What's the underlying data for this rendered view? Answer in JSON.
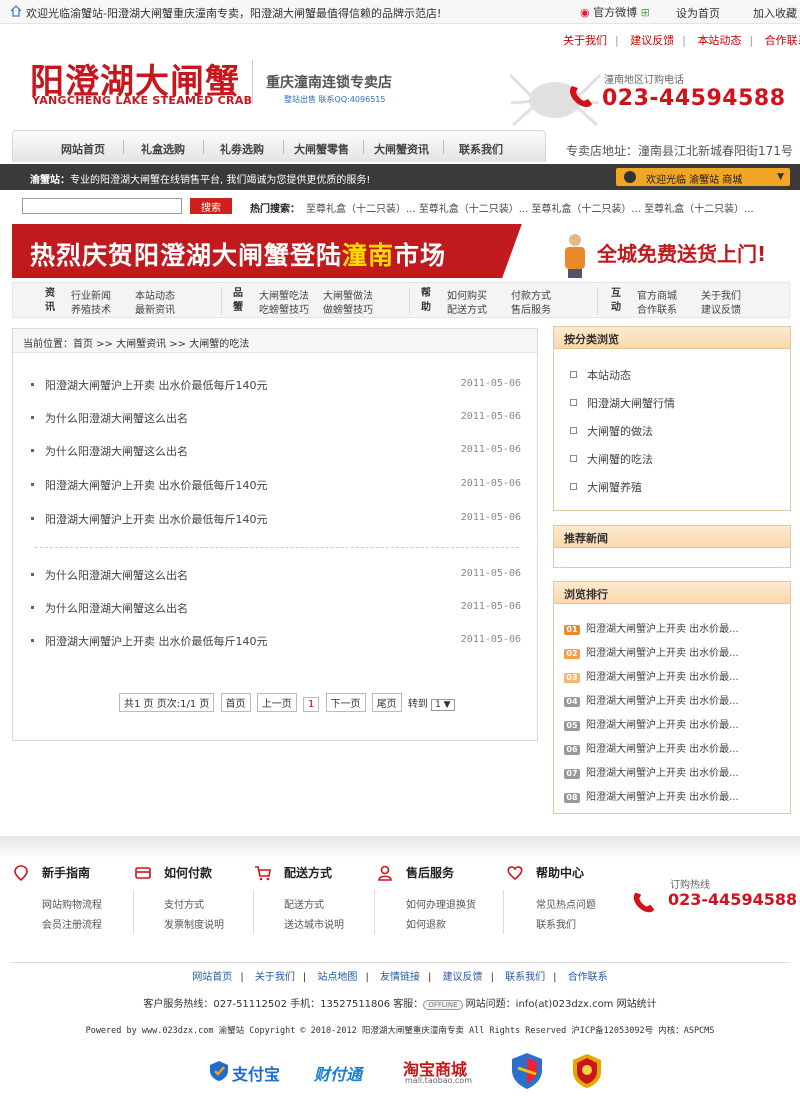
{
  "topbar": {
    "welcome": "欢迎光临渝蟹站-阳澄湖大闸蟹重庆潼南专卖，阳澄湖大闸蟹最值得信赖的品牌示范店!",
    "weibo": "官方微博",
    "set_home": "设为首页",
    "favorite": "加入收藏"
  },
  "sublinks": [
    "关于我们",
    "建议反馈",
    "本站动态",
    "合作联系"
  ],
  "logo": {
    "cn": "阳澄湖大闸蟹",
    "en": "YANGCHENG LAKE STEAMED CRAB"
  },
  "store": {
    "name": "重庆潼南连锁专卖店",
    "sub": "整站出售 联系QQ:4096515"
  },
  "phone": {
    "label": "潼南地区订购电话",
    "number": "023-44594588"
  },
  "nav": [
    "网站首页",
    "礼盒选购",
    "礼劵选购",
    "大闸蟹零售",
    "大闸蟹资讯",
    "联系我们"
  ],
  "address": "专卖店地址：潼南县江北新城春阳街171号",
  "darkbar": {
    "site": "渝蟹站：",
    "slogan": "专业的阳澄湖大闸蟹在线销售平台, 我们竭诚为您提供更优质的服务!",
    "welcome": "欢迎光临  渝蟹站  商城"
  },
  "search": {
    "placeholder": "",
    "button": "搜索",
    "hot_label": "热门搜索：",
    "hot_items": "至尊礼盒（十二只装）...  至尊礼盒（十二只装）...  至尊礼盒（十二只装）...  至尊礼盒（十二只装）..."
  },
  "banner": {
    "text_a": "热烈庆贺阳澄湖大闸蟹登陆",
    "text_hl": "潼南",
    "text_b": "市场",
    "right": "全城免费送货上门!"
  },
  "quickmenu": [
    {
      "tag": "资讯",
      "links": [
        "行业新闻",
        "本站动态",
        "养殖技术",
        "最新资讯"
      ]
    },
    {
      "tag": "品蟹",
      "links": [
        "大闸蟹吃法",
        "大闸蟹做法",
        "吃螃蟹技巧",
        "做螃蟹技巧"
      ]
    },
    {
      "tag": "帮助",
      "links": [
        "如何购买",
        "付款方式",
        "配送方式",
        "售后服务"
      ]
    },
    {
      "tag": "互动",
      "links": [
        "官方商城",
        "关于我们",
        "合作联系",
        "建议反馈"
      ]
    }
  ],
  "breadcrumb": "当前位置：首页 >> 大闸蟹资讯 >> 大闸蟹的吃法",
  "articles": [
    {
      "title": "阳澄湖大闸蟹沪上开卖 出水价最低每斤140元",
      "date": "2011-05-06"
    },
    {
      "title": "为什么阳澄湖大闸蟹这么出名",
      "date": "2011-05-06"
    },
    {
      "title": "为什么阳澄湖大闸蟹这么出名",
      "date": "2011-05-06"
    },
    {
      "title": "阳澄湖大闸蟹沪上开卖 出水价最低每斤140元",
      "date": "2011-05-06"
    },
    {
      "title": "阳澄湖大闸蟹沪上开卖 出水价最低每斤140元",
      "date": "2011-05-06"
    },
    {
      "title": "为什么阳澄湖大闸蟹这么出名",
      "date": "2011-05-06"
    },
    {
      "title": "为什么阳澄湖大闸蟹这么出名",
      "date": "2011-05-06"
    },
    {
      "title": "阳澄湖大闸蟹沪上开卖 出水价最低每斤140元",
      "date": "2011-05-06"
    }
  ],
  "pager": {
    "info": "共1 页 页次:1/1 页",
    "first": "首页",
    "prev": "上一页",
    "current": "1",
    "next": "下一页",
    "last": "尾页",
    "goto": "转到",
    "select": "1 ▼"
  },
  "categories": {
    "title": "按分类浏览",
    "items": [
      "本站动态",
      "阳澄湖大闸蟹行情",
      "大闸蟹的做法",
      "大闸蟹的吃法",
      "大闸蟹养殖"
    ]
  },
  "recommend": {
    "title": "推荐新闻"
  },
  "ranking": {
    "title": "浏览排行",
    "items": [
      {
        "n": "01",
        "t": "阳澄湖大闸蟹沪上开卖 出水价最..."
      },
      {
        "n": "02",
        "t": "阳澄湖大闸蟹沪上开卖 出水价最..."
      },
      {
        "n": "03",
        "t": "阳澄湖大闸蟹沪上开卖 出水价最..."
      },
      {
        "n": "04",
        "t": "阳澄湖大闸蟹沪上开卖 出水价最..."
      },
      {
        "n": "05",
        "t": "阳澄湖大闸蟹沪上开卖 出水价最..."
      },
      {
        "n": "06",
        "t": "阳澄湖大闸蟹沪上开卖 出水价最..."
      },
      {
        "n": "07",
        "t": "阳澄湖大闸蟹沪上开卖 出水价最..."
      },
      {
        "n": "08",
        "t": "阳澄湖大闸蟹沪上开卖 出水价最..."
      }
    ]
  },
  "footer_cols": [
    {
      "title": "新手指南",
      "links": [
        "网站购物流程",
        "会员注册流程"
      ],
      "icon": "location-pin-icon"
    },
    {
      "title": "如何付款",
      "links": [
        "支付方式",
        "发票制度说明"
      ],
      "icon": "card-icon"
    },
    {
      "title": "配送方式",
      "links": [
        "配送方式",
        "送达城市说明"
      ],
      "icon": "cart-icon"
    },
    {
      "title": "售后服务",
      "links": [
        "如何办理退换货",
        "如何退款"
      ],
      "icon": "person-icon"
    },
    {
      "title": "帮助中心",
      "links": [
        "常见热点问题",
        "联系我们"
      ],
      "icon": "heart-icon"
    }
  ],
  "hotline": {
    "label": "订购热线",
    "number": "023-44594588"
  },
  "footer_links": [
    "网站首页",
    "关于我们",
    "站点地图",
    "友情链接",
    "建议反馈",
    "联系我们",
    "合作联系"
  ],
  "footer_info": {
    "a": "客户服务热线：027-51112502 手机：13527511806 客服：",
    "offline": "OFFLINE",
    "b": " 网站问题：info(at)023dzx.com  网站统计"
  },
  "copyright": "Powered by www.023dzx.com 渝蟹站 Copyright © 2010-2012 阳澄湖大闸蟹重庆潼南专卖 All Rights Reserved 沪ICP备12053092号  内核：ASPCMS",
  "partners": {
    "alipay": "支付宝",
    "tenpay": "财付通",
    "taobao": "淘宝商城",
    "taobao_url": "mall.taobao.com"
  },
  "colors": {
    "brand_red": "#c8161d",
    "accent_orange": "#f1a625",
    "dark_bar": "#3a3a3a"
  }
}
